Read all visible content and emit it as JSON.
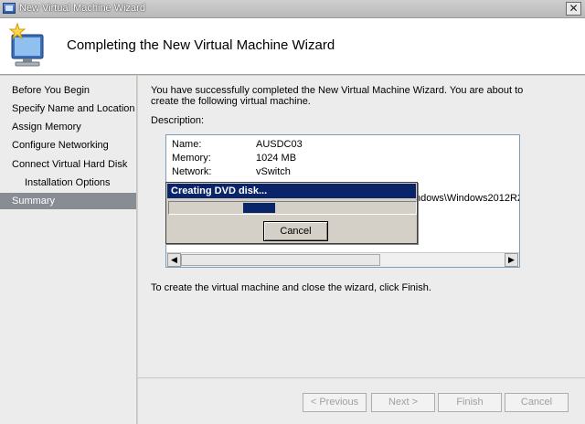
{
  "window": {
    "title": "New Virtual Machine Wizard",
    "close_glyph": "✕"
  },
  "header": {
    "title": "Completing the New Virtual Machine Wizard",
    "icon": "wizard-computer-icon"
  },
  "sidebar": {
    "items": [
      {
        "label": "Before You Begin"
      },
      {
        "label": "Specify Name and Location"
      },
      {
        "label": "Assign Memory"
      },
      {
        "label": "Configure Networking"
      },
      {
        "label": "Connect Virtual Hard Disk"
      },
      {
        "label": "Installation Options"
      },
      {
        "label": "Summary"
      }
    ],
    "active_index": 6
  },
  "main": {
    "intro": "You have successfully completed the New Virtual Machine Wizard. You are about to create the following virtual machine.",
    "description_label": "Description:",
    "description": {
      "rows": [
        {
          "key": "Name:",
          "value": "AUSDC03"
        },
        {
          "key": "Memory:",
          "value": "1024 MB"
        },
        {
          "key": "Network:",
          "value": "vSwitch"
        }
      ],
      "path_tail": "ndows\\Windows2012R2\\"
    },
    "finish_text": "To create the virtual machine and close the wizard, click Finish."
  },
  "progress": {
    "title": "Creating DVD disk...",
    "cancel_label": "Cancel",
    "fill_start_fraction": 0.3,
    "fill_width_fraction": 0.13
  },
  "footer": {
    "previous": "< Previous",
    "next": "Next >",
    "finish": "Finish",
    "cancel": "Cancel"
  }
}
